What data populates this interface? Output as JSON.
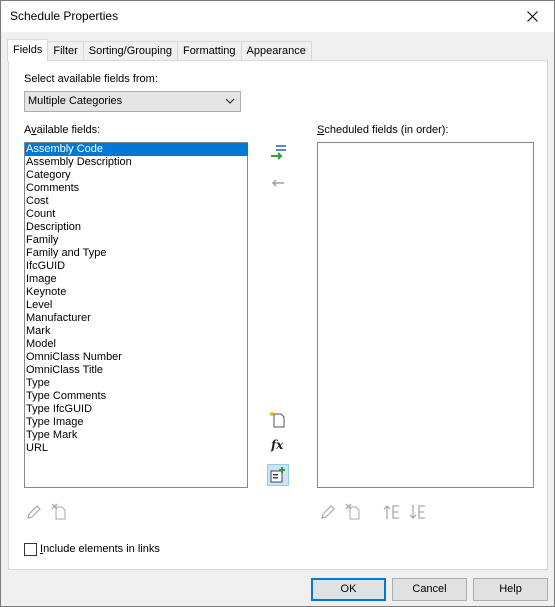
{
  "window": {
    "title": "Schedule Properties"
  },
  "tabs": [
    {
      "label": "Fields",
      "active": true
    },
    {
      "label": "Filter",
      "active": false
    },
    {
      "label": "Sorting/Grouping",
      "active": false
    },
    {
      "label": "Formatting",
      "active": false
    },
    {
      "label": "Appearance",
      "active": false
    }
  ],
  "fields_tab": {
    "select_label": "Select available fields from:",
    "category_value": "Multiple Categories",
    "available_label_pre": "A",
    "available_label_u": "v",
    "available_label_post": "ailable fields:",
    "scheduled_label_u": "S",
    "scheduled_label_post": "cheduled fields (in order):",
    "available_fields": [
      "Assembly Code",
      "Assembly Description",
      "Category",
      "Comments",
      "Cost",
      "Count",
      "Description",
      "Family",
      "Family and Type",
      "IfcGUID",
      "Image",
      "Keynote",
      "Level",
      "Manufacturer",
      "Mark",
      "Model",
      "OmniClass Number",
      "OmniClass Title",
      "Type",
      "Type Comments",
      "Type IfcGUID",
      "Type Image",
      "Type Mark",
      "URL"
    ],
    "selected_field": "Assembly Code",
    "scheduled_fields": [],
    "include_links_u": "I",
    "include_links_post": "nclude elements in links",
    "include_links_checked": false
  },
  "buttons": {
    "ok": "OK",
    "cancel": "Cancel",
    "help": "Help"
  },
  "colors": {
    "selection": "#0078d7",
    "add_arrow": "#2e9e3e",
    "panel_bg": "#ffffff"
  }
}
